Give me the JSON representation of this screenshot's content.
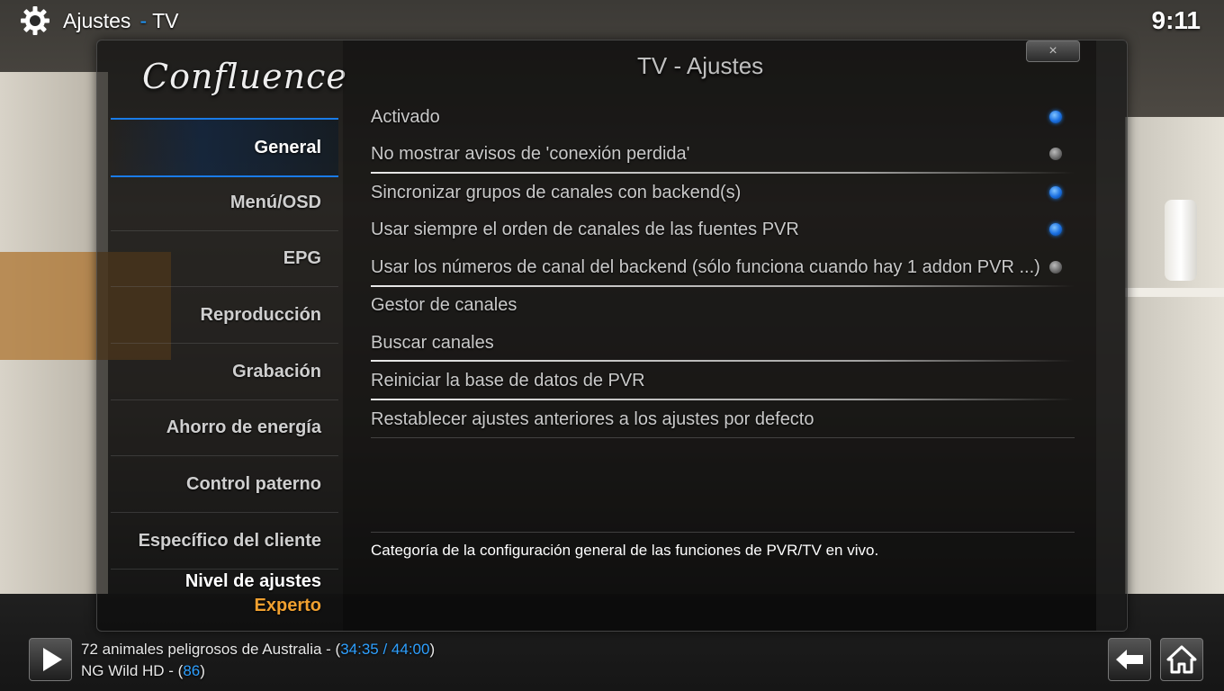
{
  "header": {
    "section": "Ajustes",
    "separator": "-",
    "subsection": "TV",
    "clock": "9:11"
  },
  "dialog": {
    "logo": "Confluence",
    "title": "TV - Ajustes",
    "close_label": "×"
  },
  "sidebar": {
    "items": [
      {
        "label": "General",
        "active": true
      },
      {
        "label": "Menú/OSD"
      },
      {
        "label": "EPG"
      },
      {
        "label": "Reproducción"
      },
      {
        "label": "Grabación"
      },
      {
        "label": "Ahorro de energía"
      },
      {
        "label": "Control paterno"
      },
      {
        "label": "Específico del cliente"
      }
    ],
    "level_label": "Nivel de ajustes",
    "level_value": "Experto"
  },
  "options": [
    {
      "label": "Activado",
      "toggle": "on"
    },
    {
      "label": "No mostrar avisos de 'conexión perdida'",
      "toggle": "off"
    },
    {
      "label": "Sincronizar grupos de canales con backend(s)",
      "toggle": "on"
    },
    {
      "label": "Usar siempre el orden de canales de las fuentes PVR",
      "toggle": "on"
    },
    {
      "label": "Usar los números de canal del backend (sólo funciona cuando hay 1 addon PVR ...)",
      "toggle": "off"
    },
    {
      "label": "Gestor de canales"
    },
    {
      "label": "Buscar canales"
    },
    {
      "label": "Reiniciar la base de datos de PVR"
    },
    {
      "label": "Restablecer ajustes anteriores a los ajustes por defecto"
    }
  ],
  "description": "Categoría de la configuración general de las funciones de PVR/TV en vivo.",
  "now_playing": {
    "title": "72 animales peligrosos de Australia - (",
    "time": "34:35 / 44:00",
    "title_end": ")",
    "channel": "NG Wild HD - (",
    "channel_number": "86",
    "channel_end": ")"
  },
  "icons": {
    "settings": "gear-icon",
    "play": "play-icon",
    "back": "back-arrow-icon",
    "home": "home-icon"
  },
  "colors": {
    "accent": "#1a7be8",
    "level": "#f0a030"
  }
}
